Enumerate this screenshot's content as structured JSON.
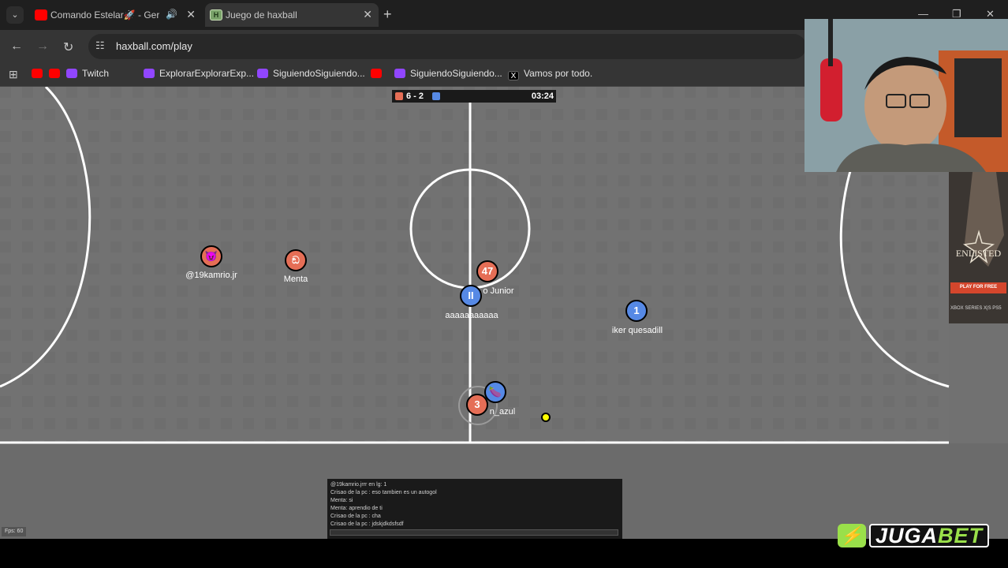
{
  "browser": {
    "tabs": [
      {
        "title": "Comando Estelar🚀 - Germ",
        "favicon": "youtube-icon",
        "audio": "🔊"
      },
      {
        "title": "Juego de haxball",
        "favicon": "haxball-icon",
        "favicon_letter": "H",
        "active": true
      }
    ],
    "new_tab_label": "+",
    "url": "haxball.com/play",
    "bookmarks": [
      {
        "label": "",
        "icon": "youtube-icon"
      },
      {
        "label": "",
        "icon": "youtube-icon"
      },
      {
        "label": "Twitch",
        "icon": "twitch-icon"
      },
      {
        "label": "ExplorarExplorarExp...",
        "icon": "twitch-icon"
      },
      {
        "label": "SiguiendoSiguiendo...",
        "icon": "twitch-icon"
      },
      {
        "label": "",
        "icon": "youtube-icon"
      },
      {
        "label": "SiguiendoSiguiendo...",
        "icon": "twitch-icon"
      },
      {
        "label": "Vamos por todo.",
        "icon": "x-icon"
      }
    ]
  },
  "game": {
    "score": "6 - 2",
    "timer": "03:24",
    "red_color": "#e56e56",
    "blue_color": "#5689e5",
    "players": [
      {
        "avatar": "😈",
        "name": "@19kamrio.jr",
        "team": "red"
      },
      {
        "avatar": "ඞ",
        "name": "Menta",
        "team": "red"
      },
      {
        "avatar": "47",
        "name": "o Junior",
        "team": "red"
      },
      {
        "avatar": "II",
        "name": "aaaaaaaaaaa",
        "team": "blue"
      },
      {
        "avatar": "1",
        "name": "iker quesadill",
        "team": "blue"
      },
      {
        "avatar": "🍆",
        "name": "n_azul",
        "team": "blue"
      },
      {
        "avatar": "3",
        "name": "",
        "team": "red"
      }
    ],
    "chat": [
      "@19kamrio.jrrr en lg: 1",
      "Crisao de la pc : eso tambien es un autogol",
      "Menta: si",
      "Menta: aprendio de ti",
      "Crisao de la pc : cha",
      "Crisao de la pc : jdskjdkdsfsdf"
    ],
    "fps": "Fps: 60"
  },
  "overlays": {
    "ad_brand": "ENLISTED",
    "ad_cta": "PLAY FOR FREE",
    "ad_platforms": "XBOX SERIES X|S  PS5",
    "sponsor_part1": "JUGA",
    "sponsor_part2": "BET"
  }
}
